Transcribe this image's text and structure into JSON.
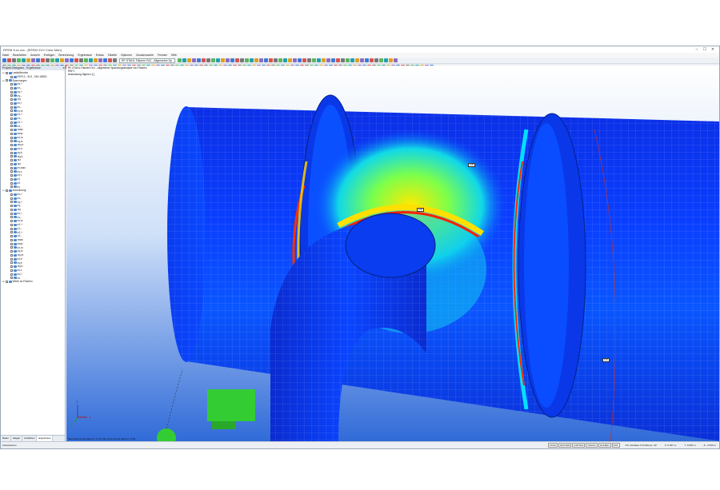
{
  "titlebar": {
    "title": "RFEM 5.xx.xxx - [RFEM XXX Color Man]",
    "min": "–",
    "max": "☐",
    "close": "✕"
  },
  "menu": [
    "Datei",
    "Bearbeiten",
    "Ansicht",
    "Einfügen",
    "Berechnung",
    "Ergebnisse",
    "Extras",
    "Tabelle",
    "Optionen",
    "Zusatzmodule",
    "Fenster",
    "Hilfe"
  ],
  "toolbar": {
    "module_select": "RF-STAHL Flächen FA1 - Allgemeine Sp"
  },
  "navigator": {
    "header": "Projekt-Navigator - Ergebnisse",
    "close": "✕",
    "tabs": [
      "Daten",
      "Zeigen",
      "Ansichten",
      "Ergebnisse"
    ],
    "active_tab": "Ergebnisse",
    "tree": [
      {
        "lvl": 0,
        "ex": "⊟",
        "label": "Lastfallkombo"
      },
      {
        "lvl": 1,
        "ex": "",
        "label": "RSF13 - SLS - DIN 18800"
      },
      {
        "lvl": 0,
        "ex": "⊟",
        "label": "Spannungen"
      },
      {
        "lvl": 1,
        "ex": "",
        "label": "σx,+"
      },
      {
        "lvl": 1,
        "ex": "",
        "label": "σx,-"
      },
      {
        "lvl": 1,
        "ex": "",
        "label": "σy,+"
      },
      {
        "lvl": 1,
        "ex": "",
        "label": "σy,-"
      },
      {
        "lvl": 1,
        "ex": "",
        "label": "τxy"
      },
      {
        "lvl": 1,
        "ex": "",
        "label": "σv,+"
      },
      {
        "lvl": 1,
        "ex": "",
        "label": "σv,-"
      },
      {
        "lvl": 1,
        "ex": "",
        "label": "σv,m"
      },
      {
        "lvl": 1,
        "ex": "",
        "label": "σ1,+"
      },
      {
        "lvl": 1,
        "ex": "",
        "label": "σ1,-"
      },
      {
        "lvl": 1,
        "ex": "",
        "label": "σ2,+"
      },
      {
        "lvl": 1,
        "ex": "",
        "label": "σ2,-"
      },
      {
        "lvl": 1,
        "ex": "",
        "label": "τmax"
      },
      {
        "lvl": 1,
        "ex": "",
        "label": "σeqv"
      },
      {
        "lvl": 1,
        "ex": "",
        "label": "σx,m"
      },
      {
        "lvl": 1,
        "ex": "",
        "label": "σy,m"
      },
      {
        "lvl": 1,
        "ex": "",
        "label": "τxy,m"
      },
      {
        "lvl": 1,
        "ex": "",
        "label": "σx,b"
      },
      {
        "lvl": 1,
        "ex": "",
        "label": "σy,b"
      },
      {
        "lvl": 1,
        "ex": "",
        "label": "τxy,b"
      },
      {
        "lvl": 1,
        "ex": "",
        "label": "τxz"
      },
      {
        "lvl": 1,
        "ex": "",
        "label": "τyz"
      },
      {
        "lvl": 1,
        "ex": "",
        "label": "σv,max"
      },
      {
        "lvl": 1,
        "ex": "",
        "label": "σv,c"
      },
      {
        "lvl": 1,
        "ex": "",
        "label": "σv,t"
      },
      {
        "lvl": 1,
        "ex": "",
        "label": "σ1"
      },
      {
        "lvl": 1,
        "ex": "",
        "label": "σ2"
      },
      {
        "lvl": 1,
        "ex": "",
        "label": "σv"
      },
      {
        "lvl": 0,
        "ex": "⊟",
        "label": "Ausnutzung"
      },
      {
        "lvl": 1,
        "ex": "",
        "label": "σx,+"
      },
      {
        "lvl": 1,
        "ex": "",
        "label": "σx,-"
      },
      {
        "lvl": 1,
        "ex": "",
        "label": "σy,+"
      },
      {
        "lvl": 1,
        "ex": "",
        "label": "σy,-"
      },
      {
        "lvl": 1,
        "ex": "",
        "label": "τxy"
      },
      {
        "lvl": 1,
        "ex": "",
        "label": "σv,+"
      },
      {
        "lvl": 1,
        "ex": "",
        "label": "σv,-"
      },
      {
        "lvl": 1,
        "ex": "",
        "label": "σv,m"
      },
      {
        "lvl": 1,
        "ex": "",
        "label": "σ1,+"
      },
      {
        "lvl": 1,
        "ex": "",
        "label": "σ1,-"
      },
      {
        "lvl": 1,
        "ex": "",
        "label": "σ2,+"
      },
      {
        "lvl": 1,
        "ex": "",
        "label": "σ2,-"
      },
      {
        "lvl": 1,
        "ex": "",
        "label": "τmax"
      },
      {
        "lvl": 1,
        "ex": "",
        "label": "σeqv"
      },
      {
        "lvl": 1,
        "ex": "",
        "label": "σx,m"
      },
      {
        "lvl": 1,
        "ex": "",
        "label": "σy,m"
      },
      {
        "lvl": 1,
        "ex": "",
        "label": "τxy,m"
      },
      {
        "lvl": 1,
        "ex": "",
        "label": "σx,b"
      },
      {
        "lvl": 1,
        "ex": "",
        "label": "σy,b"
      },
      {
        "lvl": 1,
        "ex": "",
        "label": "τxy,b"
      },
      {
        "lvl": 1,
        "ex": "",
        "label": "σv,c"
      },
      {
        "lvl": 1,
        "ex": "",
        "label": "σv,t"
      },
      {
        "lvl": 1,
        "ex": "",
        "label": "σv"
      },
      {
        "lvl": 0,
        "ex": "⊞",
        "label": "Werte an Flächen"
      }
    ]
  },
  "viewport": {
    "info_lines": [
      "RF-STAHL Flächen FA1 - Allgemeine Spannungsanalyse von Flächen",
      "RSF1",
      "Ausnutzung Sigma v [-]"
    ],
    "footer": "Max Ausnutzung Sigma v: 0.40 | Min Ausnutzung Sigma v: 0.00",
    "tags": [
      "0.28",
      "0.40",
      "0.01"
    ],
    "axis_labels": [
      "Z",
      "Y",
      "X"
    ]
  },
  "status": {
    "left": "Arbeitsebene",
    "buttons": [
      "FANG",
      "RASTER",
      "KARTES",
      "OFANG",
      "HLINIEN",
      "DXF"
    ],
    "right_text": "KS: Globales XYZ Ebene: XZ",
    "coords": [
      "X: 0.007 m",
      "Y: 0.000 m",
      "Z: -2.500 m"
    ]
  },
  "colors": {
    "background_top": "#ffffff",
    "background_bottom": "#2f6ad8",
    "support": "#33cc33"
  }
}
